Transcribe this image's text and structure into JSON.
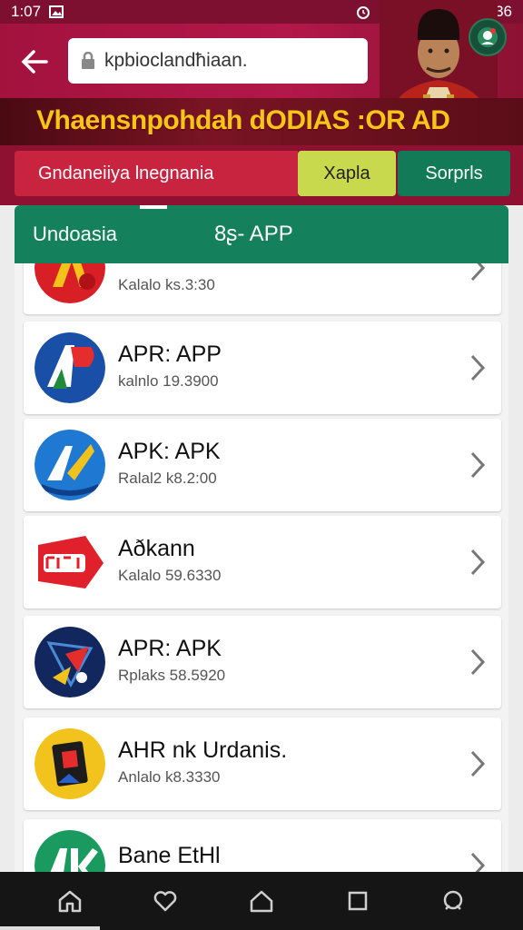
{
  "status_bar": {
    "time_left": "1:07",
    "time_right": "18:36"
  },
  "header": {
    "url": "kpbioclandħiaan.",
    "back_icon": "arrow-left-icon",
    "lock_icon": "lock-icon",
    "menu_icon": "robot-menu-icon"
  },
  "banner": {
    "text": "Vhaensnpohdah dODIAS :OR AD"
  },
  "filters": {
    "main_label": "Gndaneiiya lnegnania",
    "chip_yellow": "Xapla",
    "chip_green": "Sorprls"
  },
  "tabs": {
    "tab1": "Undoasia",
    "tab2": "8ʂ- APP"
  },
  "apps": [
    {
      "name": "",
      "meta": "Kalalo ks.3:30",
      "icon": "ap-red-icon"
    },
    {
      "name": "APR: APP",
      "meta": "kalnlo 19.3900",
      "icon": "ap-blue-icon"
    },
    {
      "name": "APK: APK",
      "meta": "Ralal2 k8.2:00",
      "icon": "ak-blue-icon"
    },
    {
      "name": "Aðkann",
      "meta": "Kalalo 59.6330",
      "icon": "pick-red-icon"
    },
    {
      "name": "APR: APK",
      "meta": "Rplaks 58.5920",
      "icon": "geo-navy-icon"
    },
    {
      "name": "AHR nk Urdanis.",
      "meta": "Anlalo k8.3330",
      "icon": "card-yellow-icon"
    },
    {
      "name": "Bane EtHl",
      "meta": "",
      "icon": "ak-green-icon"
    }
  ],
  "colors": {
    "header": "#a3123e",
    "banner_text": "#f5c518",
    "tab_green": "#15805c",
    "chip_yellow": "#c8d94e"
  }
}
